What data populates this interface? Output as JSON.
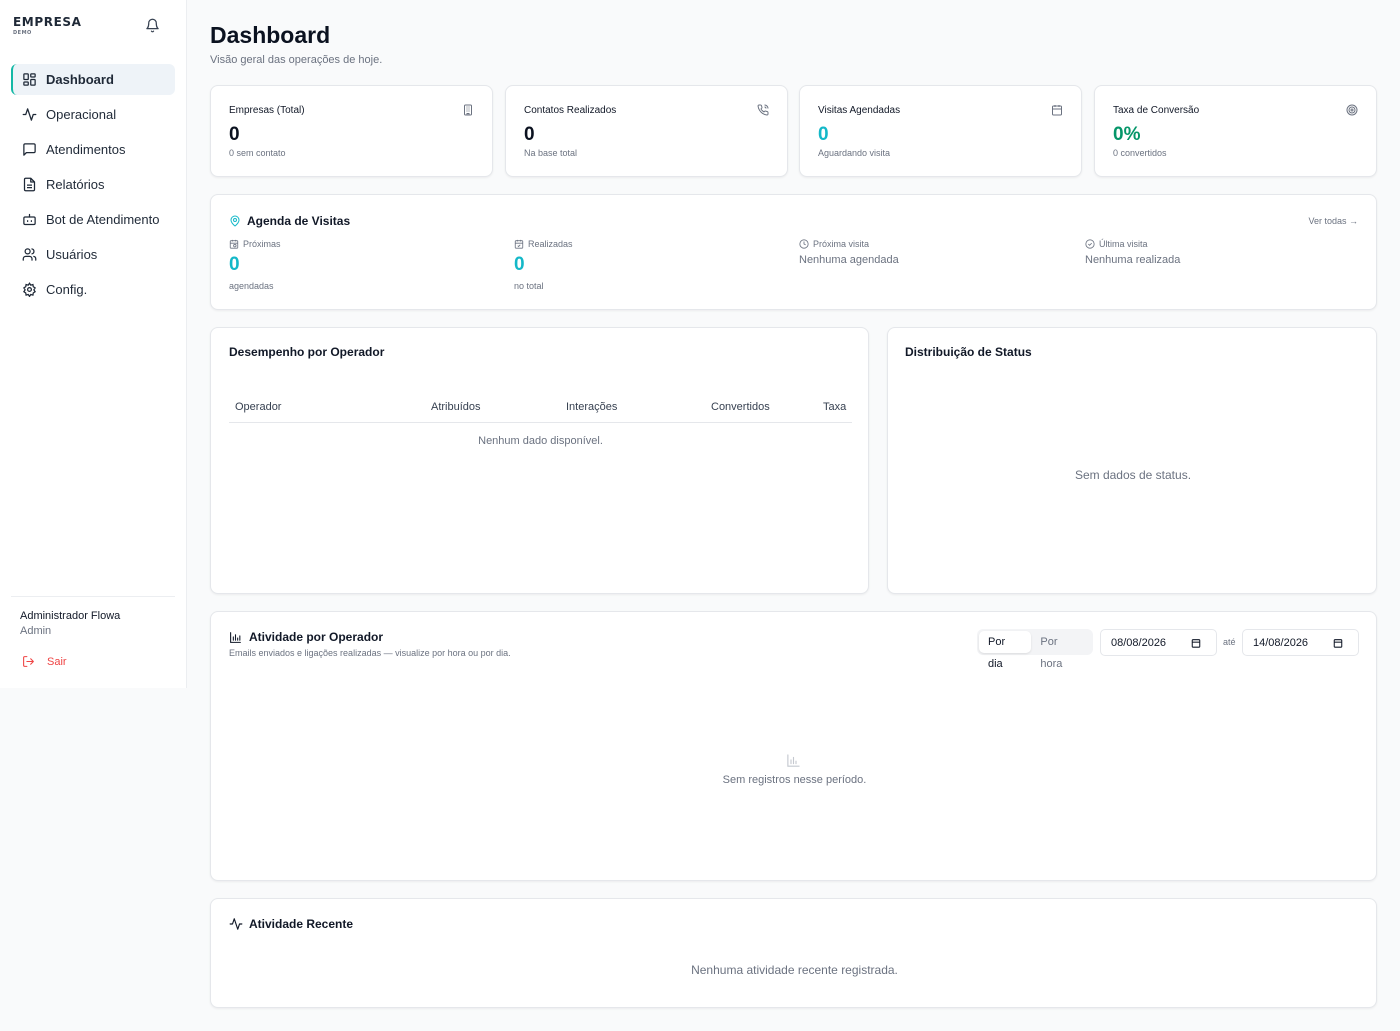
{
  "sidebar": {
    "brand": "EMPRESA",
    "brand_sub": "DEMO",
    "items": [
      {
        "label": "Dashboard",
        "icon": "grid-icon"
      },
      {
        "label": "Operacional",
        "icon": "activity-icon"
      },
      {
        "label": "Atendimentos",
        "icon": "message-square-icon"
      },
      {
        "label": "Relatórios",
        "icon": "file-text-icon"
      },
      {
        "label": "Bot de Atendimento",
        "icon": "bot-icon"
      },
      {
        "label": "Usuários",
        "icon": "users-icon"
      },
      {
        "label": "Config.",
        "icon": "gear-icon"
      }
    ],
    "user_name": "Administrador Flowa",
    "user_role": "Admin",
    "logout_label": "Sair"
  },
  "header": {
    "title": "Dashboard",
    "subtitle": "Visão geral das operações de hoje."
  },
  "stats": [
    {
      "label": "Empresas (Total)",
      "value": "0",
      "sub": "0 sem contato",
      "icon": "building-icon",
      "color": "#0b1220"
    },
    {
      "label": "Contatos Realizados",
      "value": "0",
      "sub": "Na base total",
      "icon": "phone-icon",
      "color": "#0b1220"
    },
    {
      "label": "Visitas Agendadas",
      "value": "0",
      "sub": "Aguardando visita",
      "icon": "calendar-icon",
      "color": "#14b8c8"
    },
    {
      "label": "Taxa de Conversão",
      "value": "0%",
      "sub": "0 convertidos",
      "icon": "target-icon",
      "color": "#059669"
    }
  ],
  "agenda": {
    "title": "Agenda de Visitas",
    "link": "Ver todas →",
    "proximas_label": "Próximas",
    "proximas_value": "0",
    "proximas_sub": "agendadas",
    "realizadas_label": "Realizadas",
    "realizadas_value": "0",
    "realizadas_sub": "no total",
    "proxima_visita_label": "Próxima visita",
    "proxima_visita_value": "Nenhuma agendada",
    "ultima_visita_label": "Última visita",
    "ultima_visita_value": "Nenhuma realizada"
  },
  "desempenho": {
    "title": "Desempenho por Operador",
    "columns": [
      "Operador",
      "Atribuídos",
      "Interações",
      "Convertidos",
      "Taxa"
    ],
    "empty": "Nenhum dado disponível."
  },
  "status": {
    "title": "Distribuição de Status",
    "empty": "Sem dados de status."
  },
  "atividade": {
    "title": "Atividade por Operador",
    "subtitle": "Emails enviados e ligações realizadas — visualize por hora ou por dia.",
    "por_dia": "Por dia",
    "por_hora": "Por hora",
    "date_from": "08/08/2026",
    "date_sep": "até",
    "date_to": "14/08/2026",
    "empty": "Sem registros nesse período."
  },
  "recente": {
    "title": "Atividade Recente",
    "empty": "Nenhuma atividade recente registrada."
  },
  "colors": {
    "accent": "#14b8c8",
    "success": "#059669",
    "danger": "#ef4444"
  }
}
